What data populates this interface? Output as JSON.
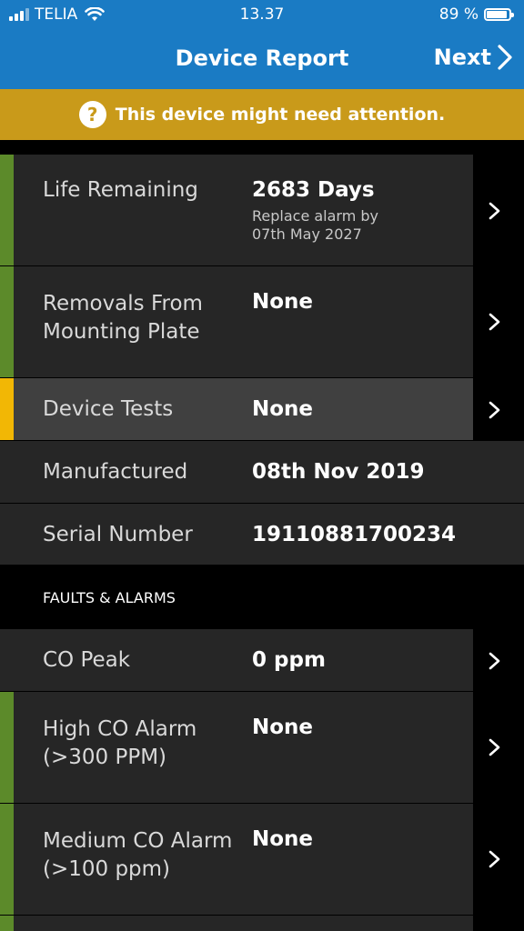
{
  "status_bar": {
    "carrier": "TELIA",
    "time": "13.37",
    "battery": "89 %"
  },
  "nav": {
    "title": "Device Report",
    "next_label": "Next"
  },
  "banner": {
    "icon": "question-icon",
    "text": "This device might need attention."
  },
  "rows": [
    {
      "label": "Life Remaining",
      "value": "2683 Days",
      "sub1": "Replace alarm by",
      "sub2": "07th May 2027",
      "accent": "#5c8a2a"
    },
    {
      "label1": "Removals From",
      "label2": "Mounting Plate",
      "value": "None",
      "accent": "#5c8a2a"
    },
    {
      "label": "Device Tests",
      "value": "None",
      "accent": "#f2b705"
    },
    {
      "label": "Manufactured",
      "value": "08th Nov 2019"
    },
    {
      "label": "Serial Number",
      "value": "19110881700234"
    }
  ],
  "faults_header": "FAULTS & ALARMS",
  "faults": [
    {
      "label": "CO Peak",
      "value": "0 ppm"
    },
    {
      "label1": "High CO Alarm",
      "label2": "(>300 PPM)",
      "value": "None",
      "accent": "#5c8a2a"
    },
    {
      "label1": "Medium CO Alarm",
      "label2": "(>100 ppm)",
      "value": "None",
      "accent": "#5c8a2a"
    }
  ],
  "colors": {
    "header_blue": "#1a7bc4",
    "banner_gold": "#c99a1a",
    "ok_green": "#5c8a2a",
    "warn_yellow": "#f2b705"
  }
}
